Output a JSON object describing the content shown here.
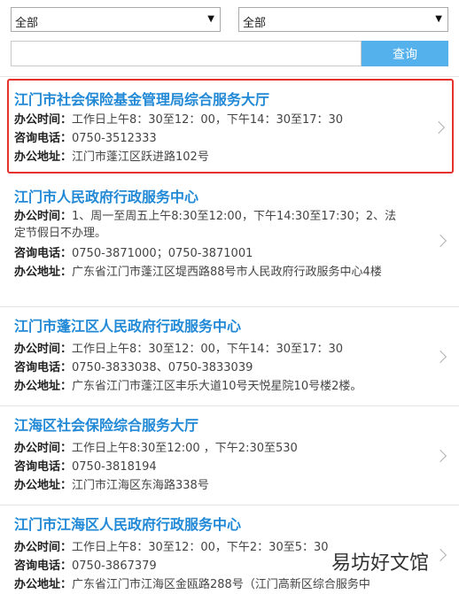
{
  "filters": {
    "select1": "全部",
    "select2": "全部",
    "search_placeholder": "",
    "query_label": "查询"
  },
  "labels": {
    "hours": "办公时间：",
    "phone": "咨询电话：",
    "address": "办公地址："
  },
  "items": [
    {
      "title": "江门市社会保险基金管理局综合服务大厅",
      "hours": "工作日上午8：30至12：00，下午14：30至17：30",
      "phone": "0750-3512333",
      "address": "江门市蓬江区跃进路102号"
    },
    {
      "title": "江门市人民政府行政服务中心",
      "hours": "1、周一至周五上午8:30至12:00，下午14:30至17:30；2、法定节假日不办理。",
      "phone": "0750-3871000；0750-3871001",
      "address": "广东省江门市蓬江区堤西路88号市人民政府行政服务中心4楼"
    },
    {
      "title": "江门市蓬江区人民政府行政服务中心",
      "hours": "工作日上午8：30至12：00，下午14：30至17：30",
      "phone": "0750-3833038、0750-3833039",
      "address": "广东省江门市蓬江区丰乐大道10号天悦星院10号楼2楼。"
    },
    {
      "title": "江海区社会保险综合服务大厅",
      "hours": "工作日上午8:30至12:00 ，下午2:30至530",
      "phone": "0750-3818194",
      "address": "江门市江海区东海路338号"
    },
    {
      "title": "江门市江海区人民政府行政服务中心",
      "hours": "工作日上午8：30至12：00，下午2：30至5：30",
      "phone": "0750-3867379",
      "address": "广东省江门市江海区金瓯路288号（江门高新区综合服务中"
    }
  ],
  "watermark": "易坊好文馆"
}
